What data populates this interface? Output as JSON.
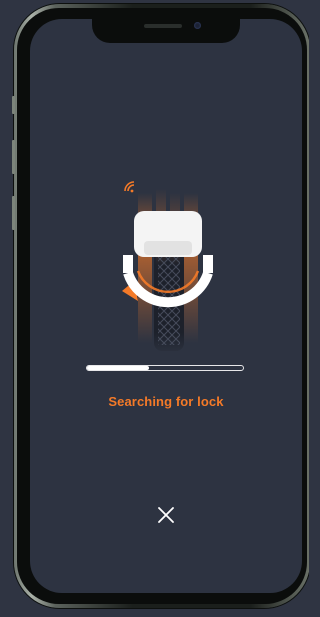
{
  "status": {
    "message": "Searching for lock",
    "progress_percent": 40
  },
  "colors": {
    "accent": "#f47a28",
    "screen_background": "#2d3341",
    "progress_fill": "#ffffff"
  },
  "icons": {
    "close": "close-icon",
    "signal": "signal-icon",
    "lock": "ring-lock-icon"
  }
}
